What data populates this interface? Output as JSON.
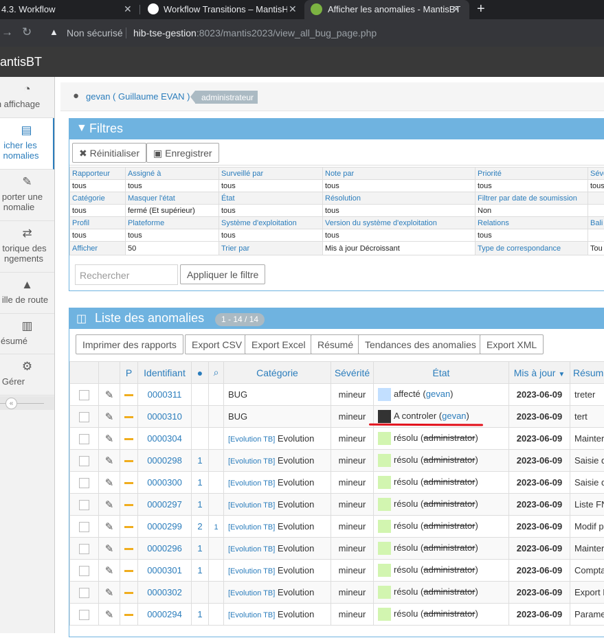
{
  "browser": {
    "tabs": [
      {
        "label": "4.3. Workflow",
        "close": "✕"
      },
      {
        "label": "Workflow Transitions – MantisHub",
        "close": "✕"
      },
      {
        "label": "Afficher les anomalies - MantisBT",
        "close": "✕"
      }
    ],
    "new_tab": "+",
    "security_label": "Non sécurisé",
    "url_host": "hib-tse-gestion",
    "url_path": ":8023/mantis2023/view_all_bug_page.php"
  },
  "app": {
    "brand": "antisBT"
  },
  "sidebar": {
    "items": [
      {
        "icon": "tachometer-icon",
        "glyph": "◔",
        "label": "n affichage"
      },
      {
        "icon": "list-icon",
        "glyph": "▤",
        "label": "icher les",
        "label2": "nomalies"
      },
      {
        "icon": "edit-icon",
        "glyph": "✎",
        "label": "porter une",
        "label2": "nomalie"
      },
      {
        "icon": "retweet-icon",
        "glyph": "⇄",
        "label": "torique des",
        "label2": "ngements"
      },
      {
        "icon": "road-icon",
        "glyph": "▲",
        "label": "ille de route"
      },
      {
        "icon": "chart-icon",
        "glyph": "▥",
        "label": "ésumé"
      },
      {
        "icon": "gears-icon",
        "glyph": "⚙",
        "label": "Gérer"
      }
    ],
    "collapse_glyph": "«"
  },
  "breadcrumb": {
    "user": "gevan ( Guillaume EVAN )",
    "role": "administrateur"
  },
  "filters": {
    "title": "Filtres",
    "reset_label": "Réinitialiser",
    "save_label": "Enregistrer",
    "rows": [
      {
        "labels": [
          "Rapporteur",
          "Assigné à",
          "Surveillé par",
          "Note par",
          "Priorité",
          "Sévé"
        ],
        "values": [
          "tous",
          "tous",
          "tous",
          "tous",
          "tous",
          "tous"
        ]
      },
      {
        "labels": [
          "Catégorie",
          "Masquer l'état",
          "État",
          "Résolution",
          "Filtrer par date de soumission",
          ""
        ],
        "values": [
          "tous",
          "fermé (Et supérieur)",
          "tous",
          "tous",
          "Non",
          ""
        ]
      },
      {
        "labels": [
          "Profil",
          "Plateforme",
          "Système d'exploitation",
          "Version du système d'exploitation",
          "Relations",
          "Bali"
        ],
        "values": [
          "tous",
          "tous",
          "tous",
          "tous",
          "tous",
          ""
        ]
      }
    ],
    "afficher_label": "Afficher",
    "afficher_value": "50",
    "trier_label": "Trier par",
    "trier_value": "Mis à jour Décroissant",
    "type_label": "Type de correspondance",
    "type_value": "Tou",
    "search_placeholder": "Rechercher",
    "apply_label": "Appliquer le filtre"
  },
  "list": {
    "title": "Liste des anomalies",
    "count": "1 - 14 / 14",
    "buttons": [
      "Imprimer des rapports",
      "Export CSV",
      "Export Excel",
      "Résumé",
      "Tendances des anomalies",
      "Export XML"
    ],
    "columns": {
      "p": "P",
      "id": "Identifiant",
      "category": "Catégorie",
      "severity": "Sévérité",
      "status": "État",
      "updated": "Mis à jour",
      "summary": "Résumé"
    },
    "rows": [
      {
        "id": "0000311",
        "notes": "",
        "files": "",
        "project": "",
        "category": "BUG",
        "severity": "mineur",
        "status": "affecté",
        "handler": "gevan",
        "strike": false,
        "color": "#c2dfff",
        "date": "2023-06-09",
        "summary": "treter"
      },
      {
        "id": "0000310",
        "notes": "",
        "files": "",
        "project": "",
        "category": "BUG",
        "severity": "mineur",
        "status": "A controler",
        "handler": "gevan",
        "strike": false,
        "color": "#333333",
        "date": "2023-06-09",
        "summary": "tert"
      },
      {
        "id": "0000304",
        "notes": "",
        "files": "",
        "project": "[Evolution TB]",
        "category": "Evolution",
        "severity": "mineur",
        "status": "résolu",
        "handler": "administrator",
        "strike": true,
        "color": "#d2f5b0",
        "date": "2023-06-09",
        "summary": "Mainter"
      },
      {
        "id": "0000298",
        "notes": "1",
        "files": "",
        "project": "[Evolution TB]",
        "category": "Evolution",
        "severity": "mineur",
        "status": "résolu",
        "handler": "administrator",
        "strike": true,
        "color": "#d2f5b0",
        "date": "2023-06-09",
        "summary": "Saisie d"
      },
      {
        "id": "0000300",
        "notes": "1",
        "files": "",
        "project": "[Evolution TB]",
        "category": "Evolution",
        "severity": "mineur",
        "status": "résolu",
        "handler": "administrator",
        "strike": true,
        "color": "#d2f5b0",
        "date": "2023-06-09",
        "summary": "Saisie d"
      },
      {
        "id": "0000297",
        "notes": "1",
        "files": "",
        "project": "[Evolution TB]",
        "category": "Evolution",
        "severity": "mineur",
        "status": "résolu",
        "handler": "administrator",
        "strike": true,
        "color": "#d2f5b0",
        "date": "2023-06-09",
        "summary": "Liste FN"
      },
      {
        "id": "0000299",
        "notes": "2",
        "files": "1",
        "project": "[Evolution TB]",
        "category": "Evolution",
        "severity": "mineur",
        "status": "résolu",
        "handler": "administrator",
        "strike": true,
        "color": "#d2f5b0",
        "date": "2023-06-09",
        "summary": "Modif p"
      },
      {
        "id": "0000296",
        "notes": "1",
        "files": "",
        "project": "[Evolution TB]",
        "category": "Evolution",
        "severity": "mineur",
        "status": "résolu",
        "handler": "administrator",
        "strike": true,
        "color": "#d2f5b0",
        "date": "2023-06-09",
        "summary": "Mainter"
      },
      {
        "id": "0000301",
        "notes": "1",
        "files": "",
        "project": "[Evolution TB]",
        "category": "Evolution",
        "severity": "mineur",
        "status": "résolu",
        "handler": "administrator",
        "strike": true,
        "color": "#d2f5b0",
        "date": "2023-06-09",
        "summary": "Compta"
      },
      {
        "id": "0000302",
        "notes": "",
        "files": "",
        "project": "[Evolution TB]",
        "category": "Evolution",
        "severity": "mineur",
        "status": "résolu",
        "handler": "administrator",
        "strike": true,
        "color": "#d2f5b0",
        "date": "2023-06-09",
        "summary": "Export I"
      },
      {
        "id": "0000294",
        "notes": "1",
        "files": "",
        "project": "[Evolution TB]",
        "category": "Evolution",
        "severity": "mineur",
        "status": "résolu",
        "handler": "administrator",
        "strike": true,
        "color": "#d2f5b0",
        "date": "2023-06-09",
        "summary": "Parame"
      }
    ]
  },
  "colors": {
    "accent": "#6fb3e0",
    "link": "#2b7dbc",
    "annotation_underline": "#e3121c"
  }
}
